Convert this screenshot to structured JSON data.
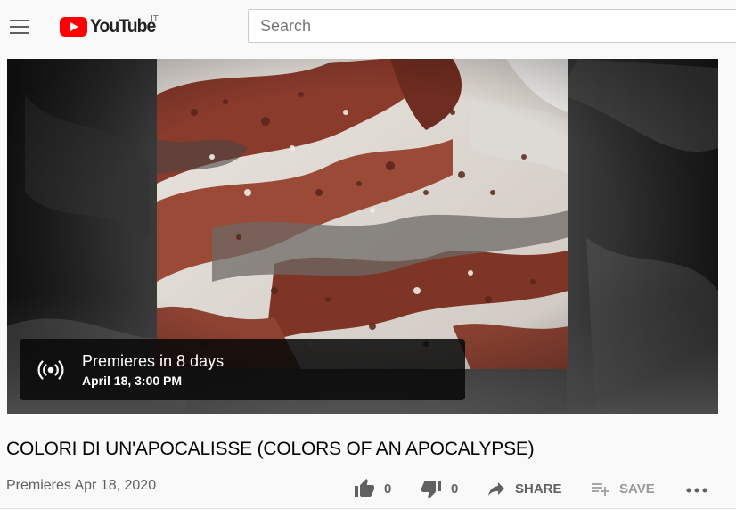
{
  "masthead": {
    "logo_text": "YouTube",
    "country_code": "IT",
    "search": {
      "placeholder": "Search",
      "value": ""
    }
  },
  "player": {
    "premiere": {
      "title": "Premieres in 8 days",
      "date": "April 18, 3:00 PM"
    }
  },
  "video": {
    "title": "COLORI DI UN'APOCALISSE (COLORS OF AN APOCALYPSE)",
    "meta": "Premieres Apr 18, 2020"
  },
  "actions": {
    "like_count": "0",
    "dislike_count": "0",
    "share_label": "SHARE",
    "save_label": "SAVE"
  },
  "icons": {
    "menu": "hamburger-icon",
    "logo": "youtube-play-icon",
    "premiere": "broadcast-icon",
    "like": "thumb-up-icon",
    "dislike": "thumb-down-icon",
    "share": "share-arrow-icon",
    "save": "playlist-add-icon",
    "more": "more-horizontal-icon"
  },
  "colors": {
    "brand_red": "#ff0000",
    "page_background": "#f9f9f9",
    "text_primary": "#030303",
    "text_secondary": "#606060"
  }
}
